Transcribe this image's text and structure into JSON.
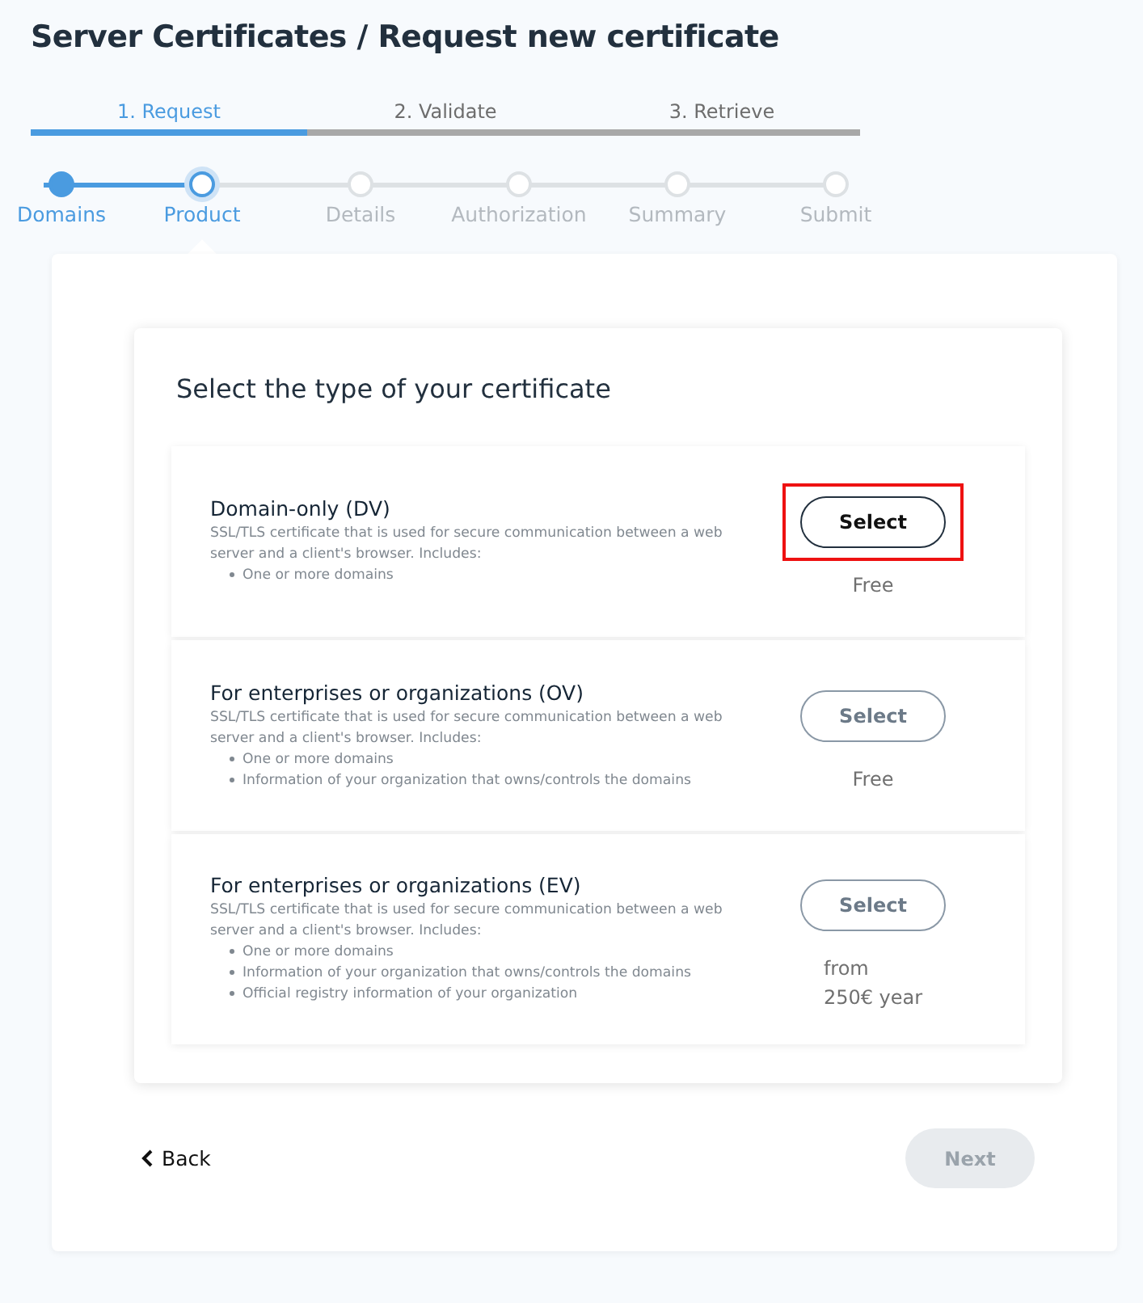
{
  "title": "Server Certificates / Request new certificate",
  "phases": [
    {
      "label": "1. Request",
      "selected": true
    },
    {
      "label": "2. Validate",
      "selected": false
    },
    {
      "label": "3. Retrieve",
      "selected": false
    }
  ],
  "steps": [
    {
      "label": "Domains",
      "completed": true,
      "selected": false
    },
    {
      "label": "Product",
      "completed": false,
      "selected": true
    },
    {
      "label": "Details",
      "completed": false,
      "selected": false
    },
    {
      "label": "Authorization",
      "completed": false,
      "selected": false
    },
    {
      "label": "Summary",
      "completed": false,
      "selected": false
    },
    {
      "label": "Submit",
      "completed": false,
      "selected": false
    }
  ],
  "heading": "Select the type of your certificate",
  "options": [
    {
      "name": "Domain-only (DV)",
      "description": "SSL/TLS certificate that is used for secure communication between a web server and a client's browser. Includes:",
      "features": [
        "One or more domains"
      ],
      "button": "Select",
      "highlighted": true,
      "price": [
        "Free"
      ]
    },
    {
      "name": "For enterprises or organizations (OV)",
      "description": "SSL/TLS certificate that is used for secure communication between a web server and a client's browser. Includes:",
      "features": [
        "One or more domains",
        "Information of your organization that owns/controls the domains"
      ],
      "button": "Select",
      "highlighted": false,
      "price": [
        "Free"
      ]
    },
    {
      "name": "For enterprises or organizations (EV)",
      "description": "SSL/TLS certificate that is used for secure communication between a web server and a client's browser. Includes:",
      "features": [
        "One or more domains",
        "Information of your organization that owns/controls the domains",
        "Official registry information of your organization"
      ],
      "button": "Select",
      "highlighted": false,
      "price": [
        "from",
        "250€ year"
      ]
    }
  ],
  "back": "Back",
  "next": {
    "label": "Next",
    "disabled": true
  }
}
